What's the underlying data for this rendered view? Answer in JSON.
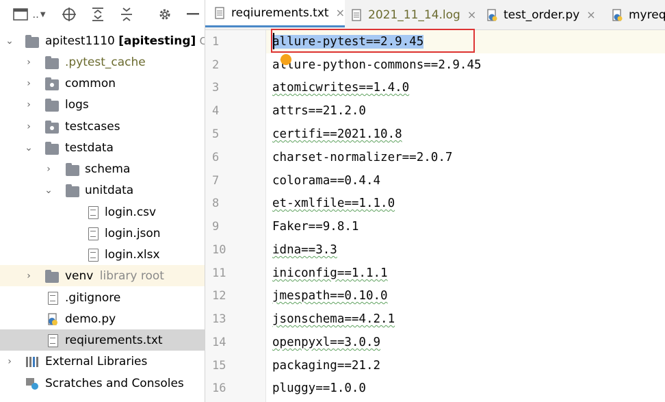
{
  "project_panel": {
    "toolbar": {
      "view_icon": "panel-icon",
      "dropdown_label": "..",
      "target_icon": "crosshair-icon",
      "expand_icon": "expand-all-icon",
      "collapse_icon": "collapse-all-icon",
      "settings_icon": "gear-icon",
      "hide_icon": "minimize-icon"
    },
    "root": {
      "name": "apitest1110",
      "module": "[apitesting]",
      "path": "C:\\U"
    },
    "items": [
      {
        "label": ".pytest_cache"
      },
      {
        "label": "common"
      },
      {
        "label": "logs"
      },
      {
        "label": "testcases"
      },
      {
        "label": "testdata"
      },
      {
        "label": "schema"
      },
      {
        "label": "unitdata"
      },
      {
        "label": "login.csv"
      },
      {
        "label": "login.json"
      },
      {
        "label": "login.xlsx"
      },
      {
        "label": "venv",
        "hint": "library root"
      },
      {
        "label": ".gitignore"
      },
      {
        "label": "demo.py"
      },
      {
        "label": "reqiurements.txt"
      },
      {
        "label": "External Libraries"
      },
      {
        "label": "Scratches and Consoles"
      }
    ]
  },
  "tabs": [
    {
      "label": "reqiurements.txt",
      "close": "×"
    },
    {
      "label": "2021_11_14.log",
      "close": "×"
    },
    {
      "label": "test_order.py",
      "close": "×"
    },
    {
      "label": "myreq"
    }
  ],
  "editor": {
    "lines": [
      {
        "num": "1",
        "text": "allure-pytest==2.9.45"
      },
      {
        "num": "2",
        "text": "allure-python-commons==2.9.45"
      },
      {
        "num": "3",
        "text": "atomicwrites==1.4.0"
      },
      {
        "num": "4",
        "text": "attrs==21.2.0"
      },
      {
        "num": "5",
        "text": "certifi==2021.10.8"
      },
      {
        "num": "6",
        "text": "charset-normalizer==2.0.7"
      },
      {
        "num": "7",
        "text": "colorama==0.4.4"
      },
      {
        "num": "8",
        "text": "et-xmlfile==1.1.0"
      },
      {
        "num": "9",
        "text": "Faker==9.8.1"
      },
      {
        "num": "10",
        "text": "idna==3.3"
      },
      {
        "num": "11",
        "text": "iniconfig==1.1.1"
      },
      {
        "num": "12",
        "text": "jmespath==0.10.0"
      },
      {
        "num": "13",
        "text": "jsonschema==4.2.1"
      },
      {
        "num": "14",
        "text": "openpyxl==3.0.9"
      },
      {
        "num": "15",
        "text": "packaging==21.2"
      },
      {
        "num": "16",
        "text": "pluggy==1.0.0"
      }
    ]
  },
  "colors": {
    "selection": "#a6c8f3",
    "highlight_box": "#dd3333",
    "tab_accent": "#4a88c7",
    "cursor_dot": "#f5a21a"
  }
}
